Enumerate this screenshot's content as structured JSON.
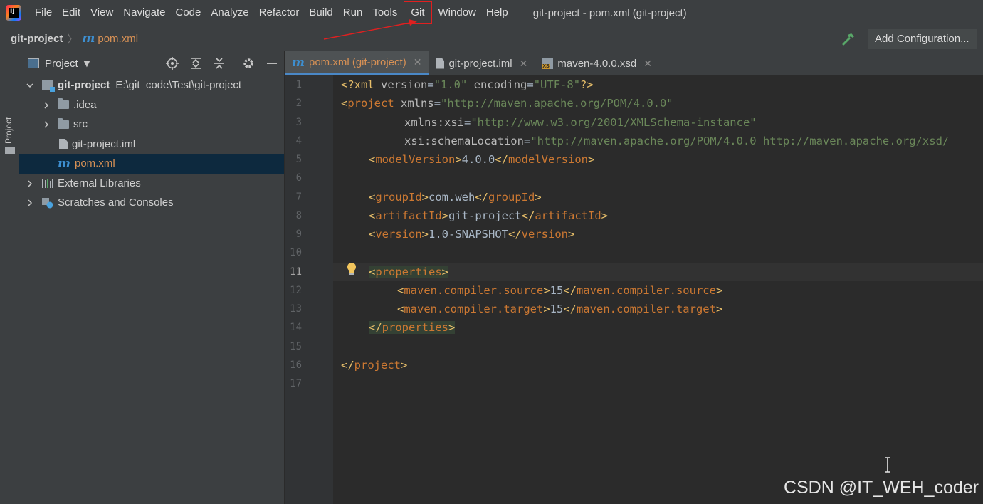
{
  "menubar": {
    "items": [
      "File",
      "Edit",
      "View",
      "Navigate",
      "Code",
      "Analyze",
      "Refactor",
      "Build",
      "Run",
      "Tools",
      "Git",
      "Window",
      "Help"
    ],
    "window_title": "git-project - pom.xml (git-project)"
  },
  "navbar": {
    "root": "git-project",
    "file": "pom.xml",
    "add_config": "Add Configuration..."
  },
  "tool_strip": {
    "label": "Project"
  },
  "project_panel": {
    "title": "Project",
    "tree": {
      "root_name": "git-project",
      "root_path": "E:\\git_code\\Test\\git-project",
      "idea": ".idea",
      "src": "src",
      "iml": "git-project.iml",
      "pom": "pom.xml",
      "libs": "External Libraries",
      "scratches": "Scratches and Consoles"
    }
  },
  "editor": {
    "tabs": [
      {
        "label": "pom.xml (git-project)",
        "active": true
      },
      {
        "label": "git-project.iml",
        "active": false
      },
      {
        "label": "maven-4.0.0.xsd",
        "active": false
      }
    ],
    "line_numbers": [
      "1",
      "2",
      "3",
      "4",
      "5",
      "6",
      "7",
      "8",
      "9",
      "10",
      "11",
      "12",
      "13",
      "14",
      "15",
      "16",
      "17"
    ],
    "current_line": 11,
    "code": {
      "l1_pi": "<?xml",
      "l1_a1": "version",
      "l1_v1": "\"1.0\"",
      "l1_a2": "encoding",
      "l1_v2": "\"UTF-8\"",
      "l1_end": "?>",
      "l2_tag": "project",
      "l2_attr": "xmlns",
      "l2_val": "\"http://maven.apache.org/POM/4.0.0\"",
      "l3_attr": "xmlns:xsi",
      "l3_val": "\"http://www.w3.org/2001/XMLSchema-instance\"",
      "l4_attr": "xsi:schemaLocation",
      "l4_val": "\"http://maven.apache.org/POM/4.0.0 http://maven.apache.org/xsd/",
      "model_tag": "modelVersion",
      "model_val": "4.0.0",
      "group_tag": "groupId",
      "group_val": "com.weh",
      "artifact_tag": "artifactId",
      "artifact_val": "git-project",
      "version_tag": "version",
      "version_val": "1.0-SNAPSHOT",
      "props_tag": "properties",
      "src_tag": "maven.compiler.source",
      "src_val": "15",
      "tgt_tag": "maven.compiler.target",
      "tgt_val": "15"
    }
  },
  "watermark": "CSDN @IT_WEH_coder",
  "colors": {
    "accent": "#4a88c7",
    "annotation": "#e02020",
    "file_orange": "#d89155"
  }
}
